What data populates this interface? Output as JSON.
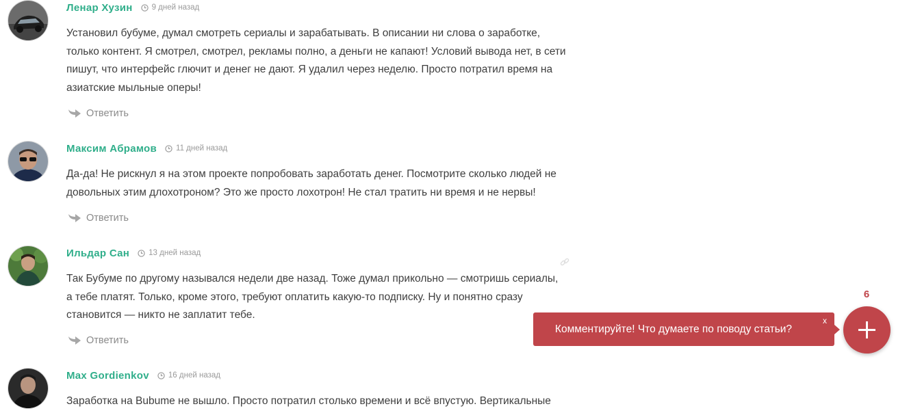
{
  "comments": [
    {
      "author": "Ленар Хузин",
      "date": "9 дней назад",
      "text": "Установил бубуме, думал смотреть сериалы и зарабатывать. В описании ни слова о заработке, только контент. Я смотрел, смотрел, рекламы полно, а деньги не капают! Условий вывода нет, в сети пишут, что интерфейс глючит и денег не дают. Я удалил через неделю. Просто потратил время на азиатские мыльные оперы!",
      "reply_label": "Ответить"
    },
    {
      "author": "Максим Абрамов",
      "date": "11 дней назад",
      "text": "Да-да! Не рискнул я на этом проекте попробовать заработать денег. Посмотрите сколько людей не довольных этим длохотроном? Это же просто лохотрон! Не стал тратить ни время и не нервы!",
      "reply_label": "Ответить"
    },
    {
      "author": "Ильдар Сан",
      "date": "13 дней назад",
      "text": "Так Бубуме по другому назывался недели две назад. Тоже думал прикольно — смотришь сериалы, а тебе платят. Только, кроме этого, требуют оплатить какую-то подписку. Ну и понятно сразу становится — никто не заплатит тебе.",
      "reply_label": "Ответить"
    },
    {
      "author": "Max Gordienkov",
      "date": "16 дней назад",
      "text": "Заработка на Bubume не вышло. Просто потратил столько времени и всё впустую. Вертикальные",
      "reply_label": ""
    }
  ],
  "cta": {
    "text": "Комментируйте! Что думаете по поводу статьи?",
    "close_label": "x",
    "count": "6"
  },
  "colors": {
    "author": "#2fae8a",
    "accent": "#c0454a",
    "text": "#3e3e3e",
    "muted": "#9a9a9a"
  },
  "icons": {
    "clock": "clock-icon",
    "reply": "reply-arrow-icon",
    "link": "link-icon",
    "add": "plus-icon"
  }
}
